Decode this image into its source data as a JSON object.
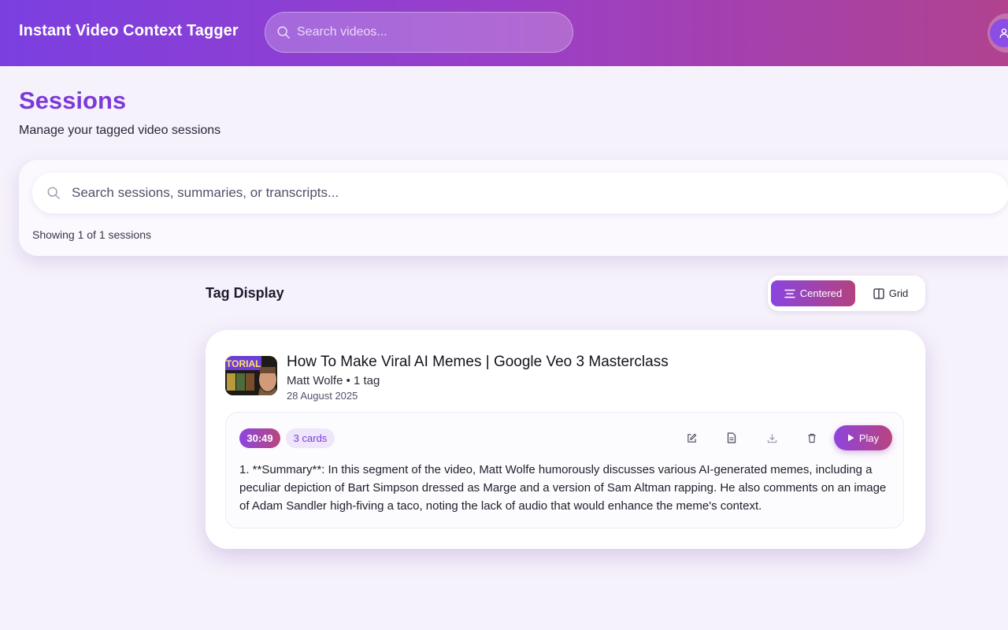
{
  "header": {
    "app_title": "Instant Video Context Tagger",
    "search_placeholder": "Search videos...",
    "icons": {
      "search": "search-icon",
      "user": "user-icon"
    }
  },
  "page": {
    "title": "Sessions",
    "subtitle": "Manage your tagged video sessions"
  },
  "session_search": {
    "placeholder": "Search sessions, summaries, or transcripts...",
    "showing_text": "Showing 1 of 1 sessions"
  },
  "tag_display": {
    "label": "Tag Display",
    "views": [
      {
        "label": "Centered",
        "icon": "align-center-icon",
        "active": true
      },
      {
        "label": "Grid",
        "icon": "columns-icon",
        "active": false
      }
    ]
  },
  "sessions": [
    {
      "thumbnail_text": "TORIAL",
      "title": "How To Make Viral AI Memes | Google Veo 3 Masterclass",
      "meta": "Matt Wolfe • 1 tag",
      "date": "28 August 2025",
      "tags": [
        {
          "timestamp": "30:49",
          "cards": "3 cards",
          "actions": [
            "edit-icon",
            "document-icon",
            "download-icon",
            "trash-icon"
          ],
          "play_label": "Play",
          "summary": "1. **Summary**: In this segment of the video, Matt Wolfe humorously discusses various AI-generated memes, including a peculiar depiction of Bart Simpson dressed as Marge and a version of Sam Altman rapping. He also comments on an image of Adam Sandler high-fiving a taco, noting the lack of audio that would enhance the meme's context."
        }
      ]
    }
  ],
  "colors": {
    "brand_purple": "#7c3ad9",
    "gradient_start": "#7b3fe0",
    "gradient_end": "#b0428f"
  }
}
